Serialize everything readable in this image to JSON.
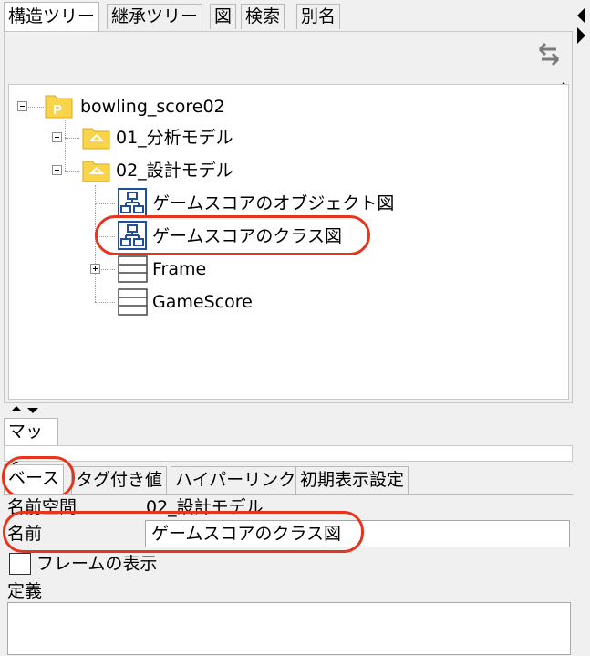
{
  "top_tabs": [
    {
      "label": "構造ツリー",
      "active": true
    },
    {
      "label": "継承ツリー",
      "active": false
    },
    {
      "label": "図",
      "active": false
    },
    {
      "label": "検索",
      "active": false
    },
    {
      "label": "別名",
      "active": false
    }
  ],
  "toolbar": {
    "sync_icon": "sync-arrows-icon"
  },
  "tree": {
    "root": {
      "label": "bowling_score02",
      "icon": "project-icon"
    },
    "package1": {
      "label": "01_分析モデル",
      "icon": "package-folder-icon"
    },
    "package2": {
      "label": "02_設計モデル",
      "icon": "package-folder-icon"
    },
    "diagram1": {
      "label": "ゲームスコアのオブジェクト図",
      "icon": "diagram-icon"
    },
    "diagram2": {
      "label": "ゲームスコアのクラス図",
      "icon": "diagram-icon"
    },
    "class1": {
      "label": "Frame",
      "icon": "class-icon"
    },
    "class2": {
      "label": "GameScore",
      "icon": "class-icon"
    }
  },
  "map": {
    "tab_label": "マップ"
  },
  "property_tabs": [
    {
      "label": "ベース",
      "active": true
    },
    {
      "label": "タグ付き値",
      "active": false
    },
    {
      "label": "ハイパーリンク",
      "active": false
    },
    {
      "label": "初期表示設定",
      "active": false
    }
  ],
  "properties": {
    "namespace_label": "名前空間",
    "namespace_value": "02_設計モデル",
    "name_label": "名前",
    "name_value": "ゲームスコアのクラス図",
    "show_frame_label": "フレームの表示",
    "show_frame_checked": false,
    "definition_label": "定義",
    "definition_value": ""
  },
  "colors": {
    "highlight": "#e8341c",
    "diagram_blue": "#1f4e9c",
    "folder_yellow": "#f7d44a"
  }
}
